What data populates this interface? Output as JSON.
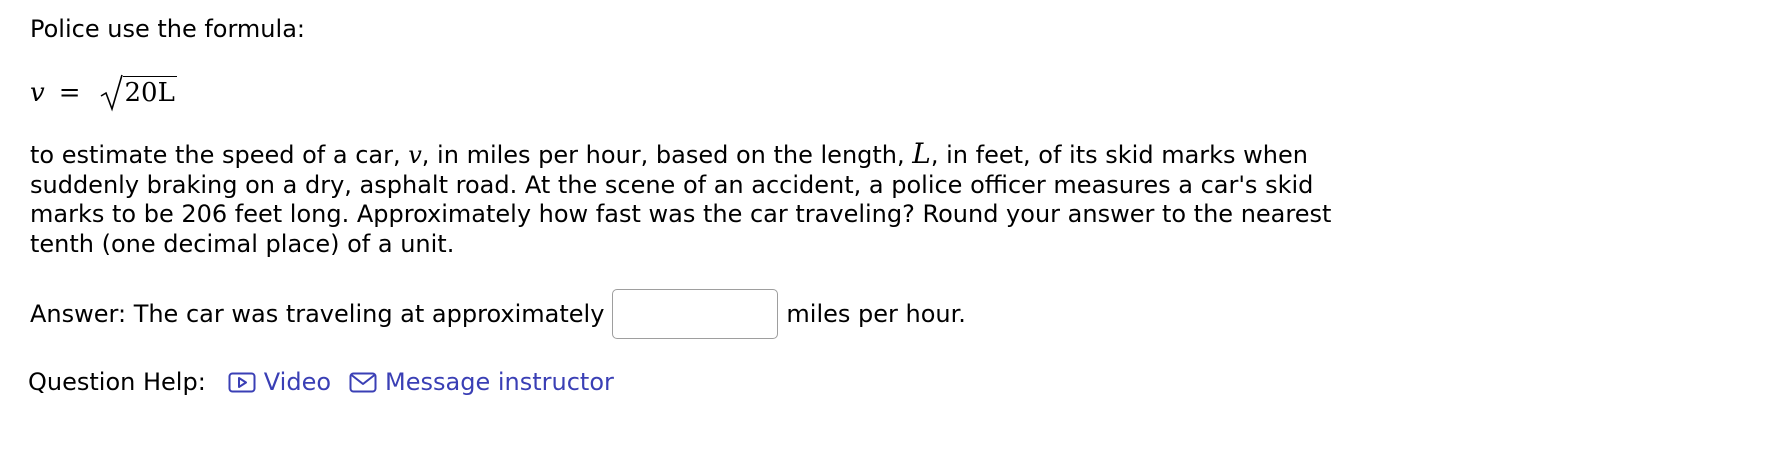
{
  "problem": {
    "intro": "Police use the formula:",
    "formula": {
      "lhs": "v",
      "equals": "=",
      "radicand": "20L"
    },
    "paragraph": {
      "line1_a": "to estimate the speed of a car, ",
      "var_v": "v",
      "line1_b": ", in miles per hour, based on the length, ",
      "var_L": "L",
      "line1_c": ", in feet, of its skid marks when",
      "line2": "suddenly braking on a dry, asphalt road. At the scene of an accident, a police officer measures a car's skid",
      "line3": "marks to be 206 feet long. Approximately how fast was the car traveling? Round your answer to the nearest",
      "line4": "tenth (one decimal place) of a unit."
    }
  },
  "answer": {
    "prefix": "Answer: The car was traveling at approximately",
    "input_value": "",
    "suffix": "miles per hour."
  },
  "help": {
    "label": "Question Help:",
    "video_label": "Video",
    "video_icon": "video-play-icon",
    "message_label": "Message instructor",
    "message_icon": "envelope-icon",
    "link_color": "#3a3fb5"
  }
}
